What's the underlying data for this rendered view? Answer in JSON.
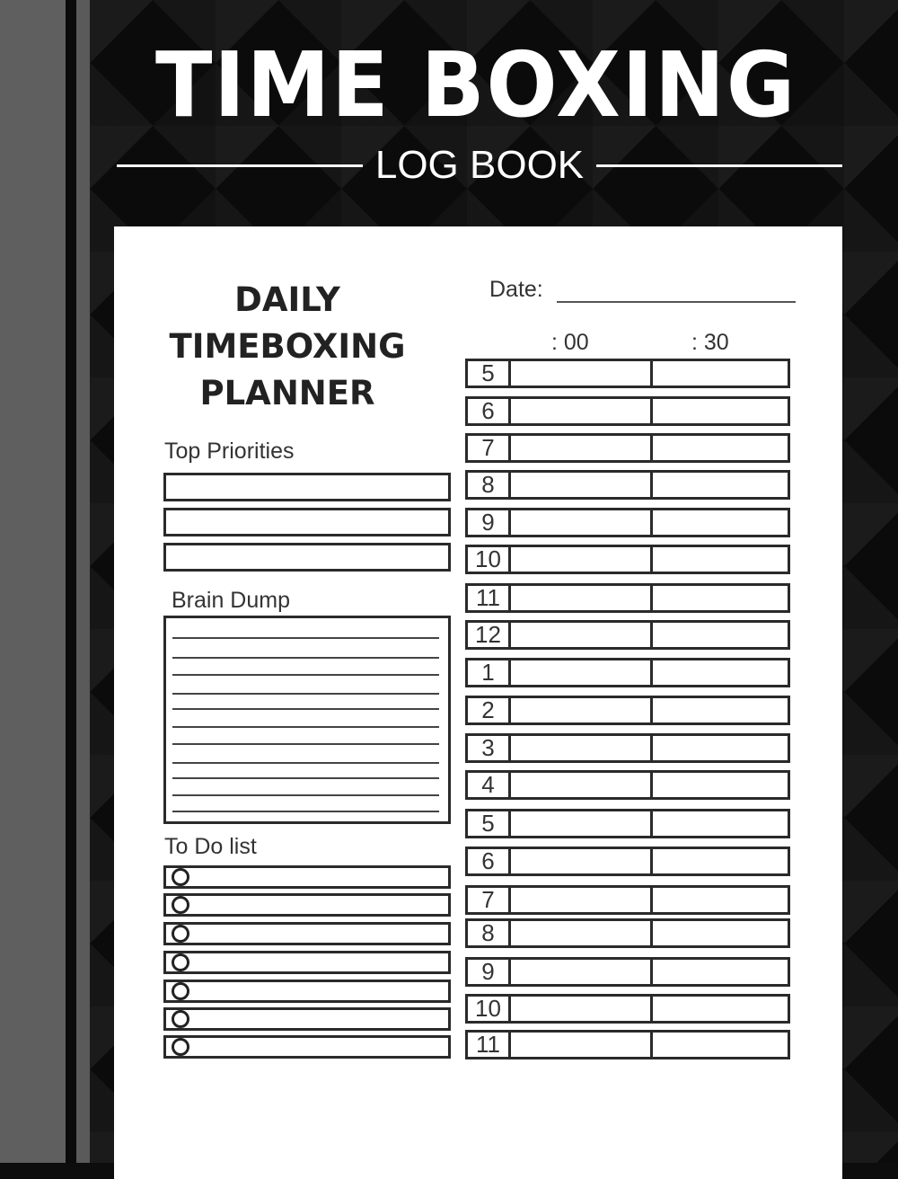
{
  "cover": {
    "title": "TIME BOXING",
    "subtitle": "LOG BOOK"
  },
  "planner": {
    "title_lines": [
      "DAILY",
      "TIMEBOXING",
      "PLANNER"
    ],
    "date_label": "Date:",
    "top_priorities_label": "Top Priorities",
    "top_priorities_count": 3,
    "brain_dump_label": "Brain Dump",
    "brain_dump_lines": 11,
    "todo_label": "To Do list",
    "todo_count": 7,
    "column_headers": [
      ": 00",
      ": 30"
    ],
    "hours": [
      "5",
      "6",
      "7",
      "8",
      "9",
      "10",
      "11",
      "12",
      "1",
      "2",
      "3",
      "4",
      "5",
      "6",
      "7",
      "8",
      "9",
      "10",
      "11"
    ]
  }
}
